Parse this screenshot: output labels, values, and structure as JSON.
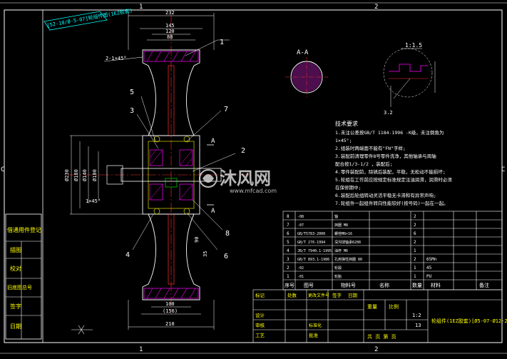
{
  "drawing": {
    "colors": {
      "background": "#000000",
      "frame": "#ffffff",
      "outline": "#ffffff",
      "dimension": "#ffffff",
      "center_line": "#ff3030",
      "hatch": "#ff00ff",
      "text_yellow": "#ffff00",
      "text_green": "#00ff00",
      "label_cyan": "#00ffff",
      "watermark": "#d7d7d7"
    },
    "grid_marks": {
      "col_a": "1",
      "col_b": "2",
      "row_left": "C",
      "row_bottom_a": "1",
      "row_bottom_b": "2"
    },
    "rotated_title": "[52-10/Ø-5-07]轮组件图(1EZ胶套)",
    "top_dims": [
      "232",
      "145",
      "120",
      "88"
    ],
    "top_left_chamfer": "2-1×45°",
    "left_dims": [
      "Ø230",
      "Ø180",
      "Ø140",
      "Ø100",
      "1×45°"
    ],
    "bottom_dims": [
      "100",
      "(156)",
      "210"
    ],
    "mid_dim": "90",
    "mid_dim2": "35",
    "small_labels": [
      "A",
      "A"
    ],
    "part_callouts": [
      "1",
      "2",
      "3",
      "4",
      "5",
      "6",
      "7",
      "8"
    ],
    "section_label": "A-A",
    "detail_scale": "1:1.5",
    "detail_dim": "3.2",
    "notes_title": "技术要求",
    "notes": [
      "1.未注公差按GB/T 1184-1996 -K级，未注倒角为",
      "1×45°;",
      "2.组装时两端面不能有\"FN\"字样;",
      "3.装配前清理零件8号零件洗净，其他轴承与周轴",
      "配合按1/3-1/2 ，装配后;",
      "4.零件装配前，除锈后装配，平稳，无松动不能损坏;",
      "5.轮组在工作前应按规定标准规定注油润滑，润滑时必须",
      "在保修期中;",
      "6.装配后轮组转动灵活平稳无卡滞和有异常声响;",
      "7.轮组件一起组件转向性能较好(按号码)一起在一起。"
    ],
    "watermark": {
      "brand": "沐风网",
      "url": "www.mfcad.com"
    },
    "parts_table": {
      "rows": [
        {
          "no": "8",
          "code": "-08",
          "name": "轴",
          "qty": "2",
          "material": "",
          "note": ""
        },
        {
          "no": "7",
          "code": "-07",
          "name": "挡圈 M8",
          "qty": "2",
          "material": "",
          "note": ""
        },
        {
          "no": "6",
          "code": "GB/T5783-2000",
          "name": "螺栓M8×16",
          "qty": "6",
          "material": "",
          "note": ""
        },
        {
          "no": "5",
          "code": "GB/T 276-1994",
          "name": "深沟球轴承6208",
          "qty": "2",
          "material": "",
          "note": ""
        },
        {
          "no": "4",
          "code": "JB/T 7940.1-1995",
          "name": "油杯 M6",
          "qty": "1",
          "material": "",
          "note": ""
        },
        {
          "no": "3",
          "code": "GB/T 893.1-1986",
          "name": "孔用弹性挡圈 80",
          "qty": "2",
          "material": "65Mn",
          "note": ""
        },
        {
          "no": "2",
          "code": "-02",
          "name": "轮毂",
          "qty": "1",
          "material": "45",
          "note": ""
        },
        {
          "no": "1",
          "code": "-01",
          "name": "轮胎",
          "qty": "1",
          "material": "PU",
          "note": ""
        }
      ],
      "header": [
        "序号",
        "图号",
        "物料号",
        "名称",
        "数量",
        "材料",
        "备注"
      ]
    },
    "title_block": {
      "labels": [
        "标记",
        "处数",
        "更改文件号",
        "签字",
        "日期",
        "设计",
        "审核",
        "工艺",
        "标准化",
        "批准"
      ],
      "weight_label": "重量",
      "scale_label": "比例",
      "sheet_label": "共 页 第 页",
      "scale_value": "1:2",
      "count_value": "13",
      "drawing_name": "轮组件(1EZ胶套)[Ø5-07-Ø12-25]"
    },
    "side_strip": [
      "借通用件登记",
      "描图",
      "校对",
      "旧底图总号",
      "签字",
      "日期"
    ]
  }
}
